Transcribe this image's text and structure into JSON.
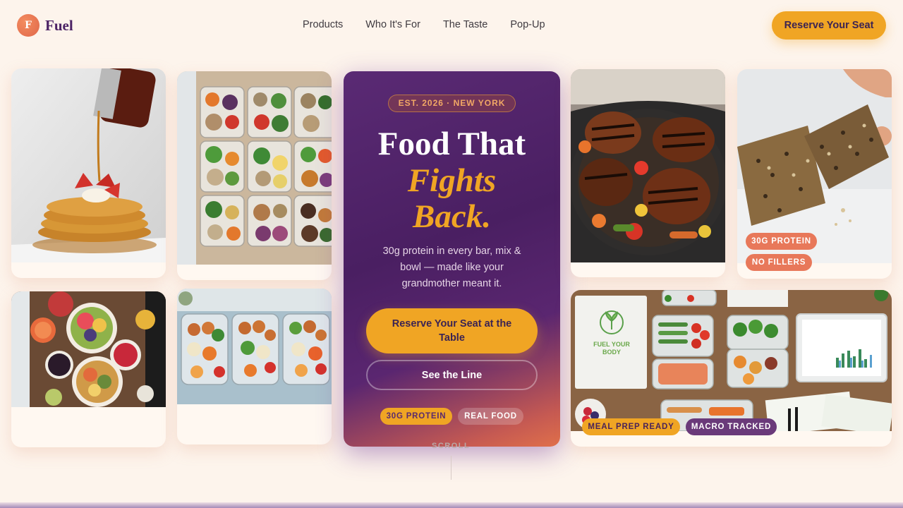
{
  "brand": {
    "initial": "F",
    "name": "Fuel"
  },
  "nav": {
    "items": [
      "Products",
      "Who It's For",
      "The Taste",
      "Pop-Up"
    ]
  },
  "header_cta": "Reserve Your Seat",
  "hero": {
    "badge": "EST. 2026 · NEW YORK",
    "title_line1": "Food That",
    "title_line2": "Fights",
    "title_line3": "Back.",
    "subtitle": "30g protein in every bar, mix & bowl — made like your grandmother meant it.",
    "primary_button": "Reserve Your Seat at the Table",
    "secondary_button": "See the Line",
    "tags": [
      "30G PROTEIN",
      "REAL FOOD"
    ]
  },
  "protein_bar_card": {
    "tags": [
      "30G PROTEIN",
      "NO FILLERS"
    ]
  },
  "meal_prep_card": {
    "notebook_text": "FUEL YOUR BODY",
    "tags": [
      "MEAL PREP READY",
      "MACRO TRACKED"
    ]
  },
  "scroll_label": "SCROLL",
  "colors": {
    "accent": "#f0a524",
    "brand_purple": "#4c2366",
    "coral": "#e8785a",
    "background": "#fdf4ec"
  }
}
